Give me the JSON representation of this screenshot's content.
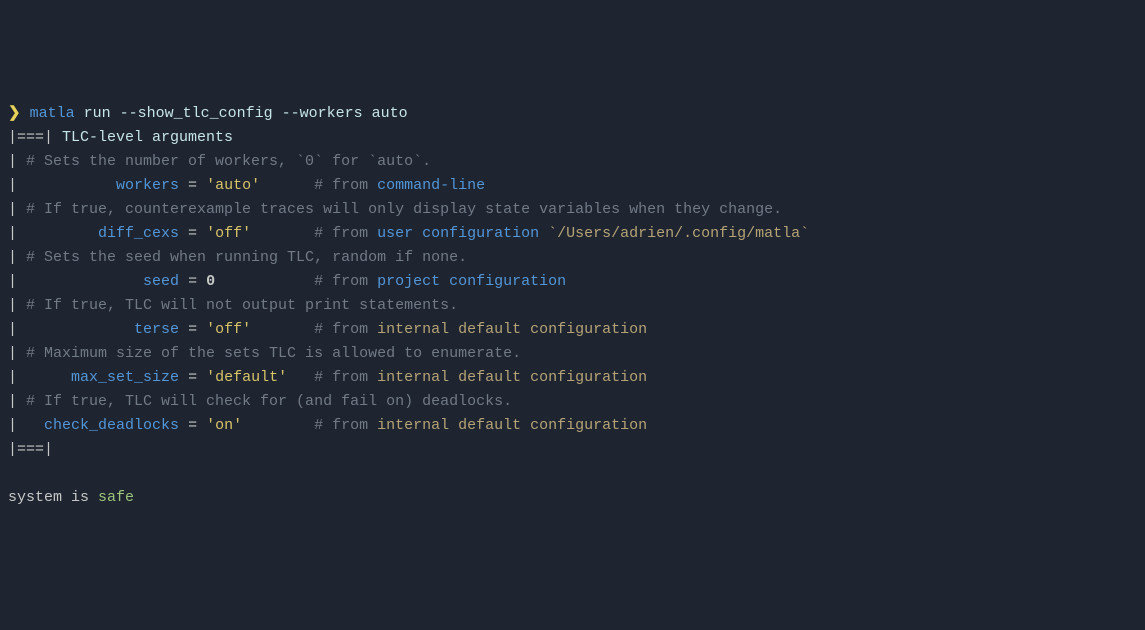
{
  "prompt": "❯",
  "command": {
    "name": "matla",
    "args": "run --show_tlc_config --workers auto"
  },
  "header": {
    "prefix": "|===|",
    "title": "TLC-level arguments"
  },
  "entries": [
    {
      "comment": "# Sets the number of workers, `0` for `auto`.",
      "key": "workers",
      "value": "'auto'",
      "valueType": "str",
      "pad1": "          ",
      "pad2": "      ",
      "source": "command-line",
      "sourceClass": "source-blue",
      "path": ""
    },
    {
      "comment": "# If true, counterexample traces will only display state variables when they change.",
      "key": "diff_cexs",
      "value": "'off'",
      "valueType": "str",
      "pad1": "        ",
      "pad2": "       ",
      "source": "user configuration",
      "sourceClass": "source-blue",
      "path": " `/Users/adrien/.config/matla`"
    },
    {
      "comment": "# Sets the seed when running TLC, random if none.",
      "key": "seed",
      "value": "0",
      "valueType": "num",
      "pad1": "             ",
      "pad2": "           ",
      "source": "project configuration",
      "sourceClass": "source-blue",
      "path": ""
    },
    {
      "comment": "# If true, TLC will not output print statements.",
      "key": "terse",
      "value": "'off'",
      "valueType": "str",
      "pad1": "            ",
      "pad2": "       ",
      "source": "internal default configuration",
      "sourceClass": "source-tan",
      "path": ""
    },
    {
      "comment": "# Maximum size of the sets TLC is allowed to enumerate.",
      "key": "max_set_size",
      "value": "'default'",
      "valueType": "str",
      "pad1": "     ",
      "pad2": "   ",
      "source": "internal default configuration",
      "sourceClass": "source-tan",
      "path": ""
    },
    {
      "comment": "# If true, TLC will check for (and fail on) deadlocks.",
      "key": "check_deadlocks",
      "value": "'on'",
      "valueType": "str",
      "pad1": "  ",
      "pad2": "        ",
      "source": "internal default configuration",
      "sourceClass": "source-tan",
      "path": ""
    }
  ],
  "footer": "|===|",
  "result": {
    "prefix": "system is ",
    "status": "safe"
  }
}
